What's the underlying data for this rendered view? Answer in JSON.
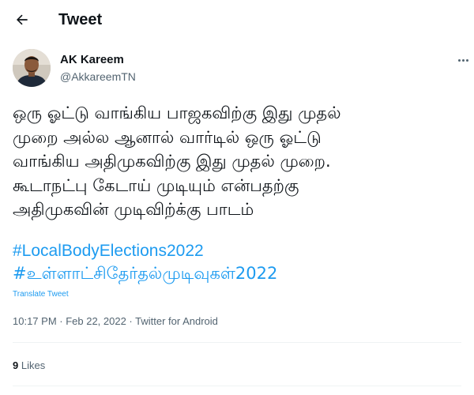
{
  "header": {
    "back_icon": "arrow-left-icon",
    "title": "Tweet"
  },
  "tweet": {
    "author_name": "AK Kareem",
    "author_handle": "@AkkareemTN",
    "more_icon": "more-horizontal-icon",
    "text": "ஒரு ஓட்டு வாங்கிய பாஜகவிற்கு இது முதல்\nமுறை அல்ல ஆனால் வார்டில் ஒரு ஓட்டு\nவாங்கிய அதிமுகவிற்கு இது முதல் முறை.\nகூடாநட்பு கேடாய் முடியும் என்பதற்கு\nஅதிமுகவின் முடிவிற்க்கு பாடம்",
    "hashtags": [
      "#LocalBodyElections2022",
      "#உள்ளாட்சிதேர்தல்முடிவுகள்2022"
    ],
    "translate_label": "Translate Tweet",
    "timestamp": "10:17 PM · Feb 22, 2022 · Twitter for Android",
    "likes_count": "9",
    "likes_label": "Likes"
  },
  "colors": {
    "link": "#1d9bf0",
    "text": "#0f1419",
    "secondary": "#536471"
  }
}
